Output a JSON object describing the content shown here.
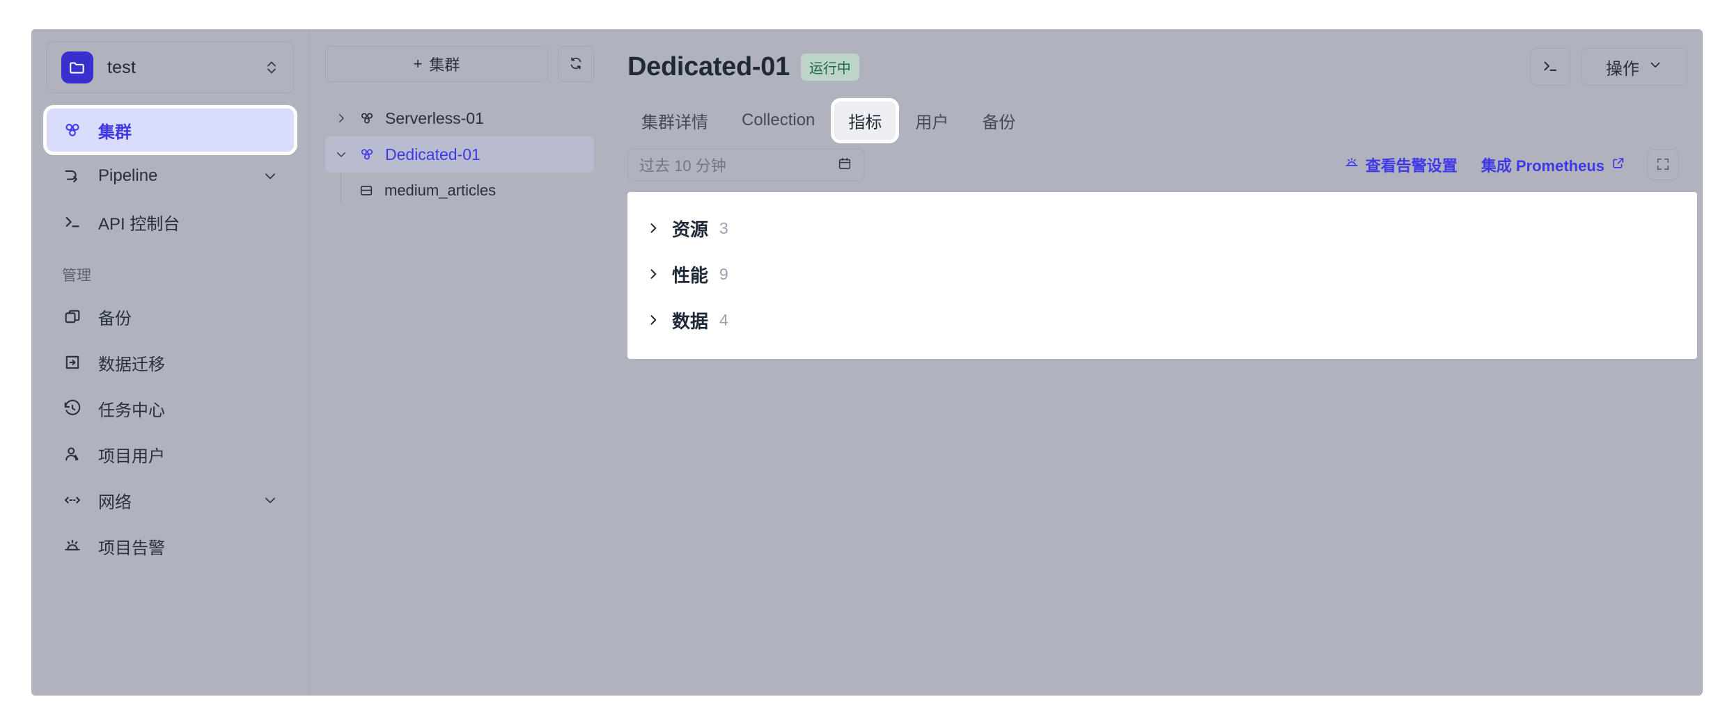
{
  "sidebar": {
    "project": {
      "name": "test",
      "icon": "folder-icon",
      "switch_icon": "chevron-up-down-icon"
    },
    "items": [
      {
        "label": "集群",
        "icon": "cluster-icon",
        "active": true,
        "expandable": false
      },
      {
        "label": "Pipeline",
        "icon": "pipeline-icon",
        "active": false,
        "expandable": true
      },
      {
        "label": "API 控制台",
        "icon": "terminal-icon",
        "active": false,
        "expandable": false
      }
    ],
    "group_label": "管理",
    "manage_items": [
      {
        "label": "备份",
        "icon": "copy-icon",
        "expandable": false
      },
      {
        "label": "数据迁移",
        "icon": "data-migration-icon",
        "expandable": false
      },
      {
        "label": "任务中心",
        "icon": "history-clock-icon",
        "expandable": false
      },
      {
        "label": "项目用户",
        "icon": "user-icon",
        "expandable": false
      },
      {
        "label": "网络",
        "icon": "network-icon",
        "expandable": true
      },
      {
        "label": "项目告警",
        "icon": "alarm-icon",
        "expandable": false
      }
    ]
  },
  "tree_panel": {
    "add_button_label": "集群",
    "add_button_prefix": "+",
    "refresh_icon": "refresh-icon",
    "nodes": [
      {
        "label": "Serverless-01",
        "expanded": false,
        "selected": false,
        "icon": "cluster-icon"
      },
      {
        "label": "Dedicated-01",
        "expanded": true,
        "selected": true,
        "icon": "cluster-icon"
      }
    ],
    "children": [
      {
        "label": "medium_articles",
        "icon": "collection-icon"
      }
    ]
  },
  "header": {
    "title": "Dedicated-01",
    "status": "运行中",
    "status_color": "#1d6b45",
    "status_bg": "#bfd4c8",
    "terminal_icon": "terminal-icon",
    "action_label": "操作",
    "action_caret": "chevron-down-icon"
  },
  "tabs": [
    {
      "label": "集群详情",
      "active": false
    },
    {
      "label": "Collection",
      "active": false
    },
    {
      "label": "指标",
      "active": true
    },
    {
      "label": "用户",
      "active": false
    },
    {
      "label": "备份",
      "active": false
    }
  ],
  "metrics_toolbar": {
    "range_value": "过去 10 分钟",
    "range_placeholder": "过去 10 分钟",
    "calendar_icon": "calendar-icon",
    "alert_link": {
      "label": "查看告警设置",
      "icon": "alarm-icon"
    },
    "prometheus_link": {
      "label": "集成 Prometheus",
      "icon": "external-link-icon"
    },
    "fullscreen_icon": "fullscreen-icon"
  },
  "metric_sections": [
    {
      "title": "资源",
      "count": "3",
      "expanded": false
    },
    {
      "title": "性能",
      "count": "9",
      "expanded": false
    },
    {
      "title": "数据",
      "count": "4",
      "expanded": false
    }
  ],
  "colors": {
    "app_bg": "#b0b3bd",
    "accent": "#4038e8",
    "accent_soft": "#d9dcfb",
    "card_bg": "#ffffff",
    "text": "#27303f",
    "muted": "#9aa1b0"
  }
}
